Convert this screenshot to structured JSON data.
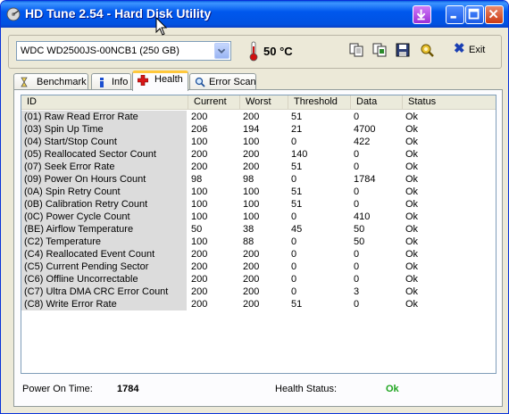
{
  "window": {
    "title": "HD Tune 2.54 - Hard Disk Utility"
  },
  "toolbar": {
    "drive": "WDC WD2500JS-00NCB1 (250 GB)",
    "temperature": "50 °C",
    "exit_label": "Exit",
    "icons": [
      "copy-icon",
      "copy-all-icon",
      "save-icon",
      "options-icon",
      "exit-icon"
    ]
  },
  "tabs": [
    {
      "label": "Benchmark",
      "icon": "benchmark-icon",
      "active": false
    },
    {
      "label": "Info",
      "icon": "info-icon",
      "active": false
    },
    {
      "label": "Health",
      "icon": "health-cross-icon",
      "active": true
    },
    {
      "label": "Error Scan",
      "icon": "magnifier-icon",
      "active": false
    }
  ],
  "grid": {
    "columns": [
      "ID",
      "Current",
      "Worst",
      "Threshold",
      "Data",
      "Status"
    ],
    "rows": [
      [
        "(01) Raw Read Error Rate",
        "200",
        "200",
        "51",
        "0",
        "Ok"
      ],
      [
        "(03) Spin Up Time",
        "206",
        "194",
        "21",
        "4700",
        "Ok"
      ],
      [
        "(04) Start/Stop Count",
        "100",
        "100",
        "0",
        "422",
        "Ok"
      ],
      [
        "(05) Reallocated Sector Count",
        "200",
        "200",
        "140",
        "0",
        "Ok"
      ],
      [
        "(07) Seek Error Rate",
        "200",
        "200",
        "51",
        "0",
        "Ok"
      ],
      [
        "(09) Power On Hours Count",
        "98",
        "98",
        "0",
        "1784",
        "Ok"
      ],
      [
        "(0A) Spin Retry Count",
        "100",
        "100",
        "51",
        "0",
        "Ok"
      ],
      [
        "(0B) Calibration Retry Count",
        "100",
        "100",
        "51",
        "0",
        "Ok"
      ],
      [
        "(0C) Power Cycle Count",
        "100",
        "100",
        "0",
        "410",
        "Ok"
      ],
      [
        "(BE) Airflow Temperature",
        "50",
        "38",
        "45",
        "50",
        "Ok"
      ],
      [
        "(C2) Temperature",
        "100",
        "88",
        "0",
        "50",
        "Ok"
      ],
      [
        "(C4) Reallocated Event Count",
        "200",
        "200",
        "0",
        "0",
        "Ok"
      ],
      [
        "(C5) Current Pending Sector",
        "200",
        "200",
        "0",
        "0",
        "Ok"
      ],
      [
        "(C6) Offline Uncorrectable",
        "200",
        "200",
        "0",
        "0",
        "Ok"
      ],
      [
        "(C7) Ultra DMA CRC Error Count",
        "200",
        "200",
        "0",
        "3",
        "Ok"
      ],
      [
        "(C8) Write Error Rate",
        "200",
        "200",
        "51",
        "0",
        "Ok"
      ]
    ]
  },
  "status": {
    "power_on_label": "Power On Time:",
    "power_on_value": "1784",
    "health_label": "Health Status:",
    "health_value": "Ok",
    "health_color": "#1fa51f"
  }
}
